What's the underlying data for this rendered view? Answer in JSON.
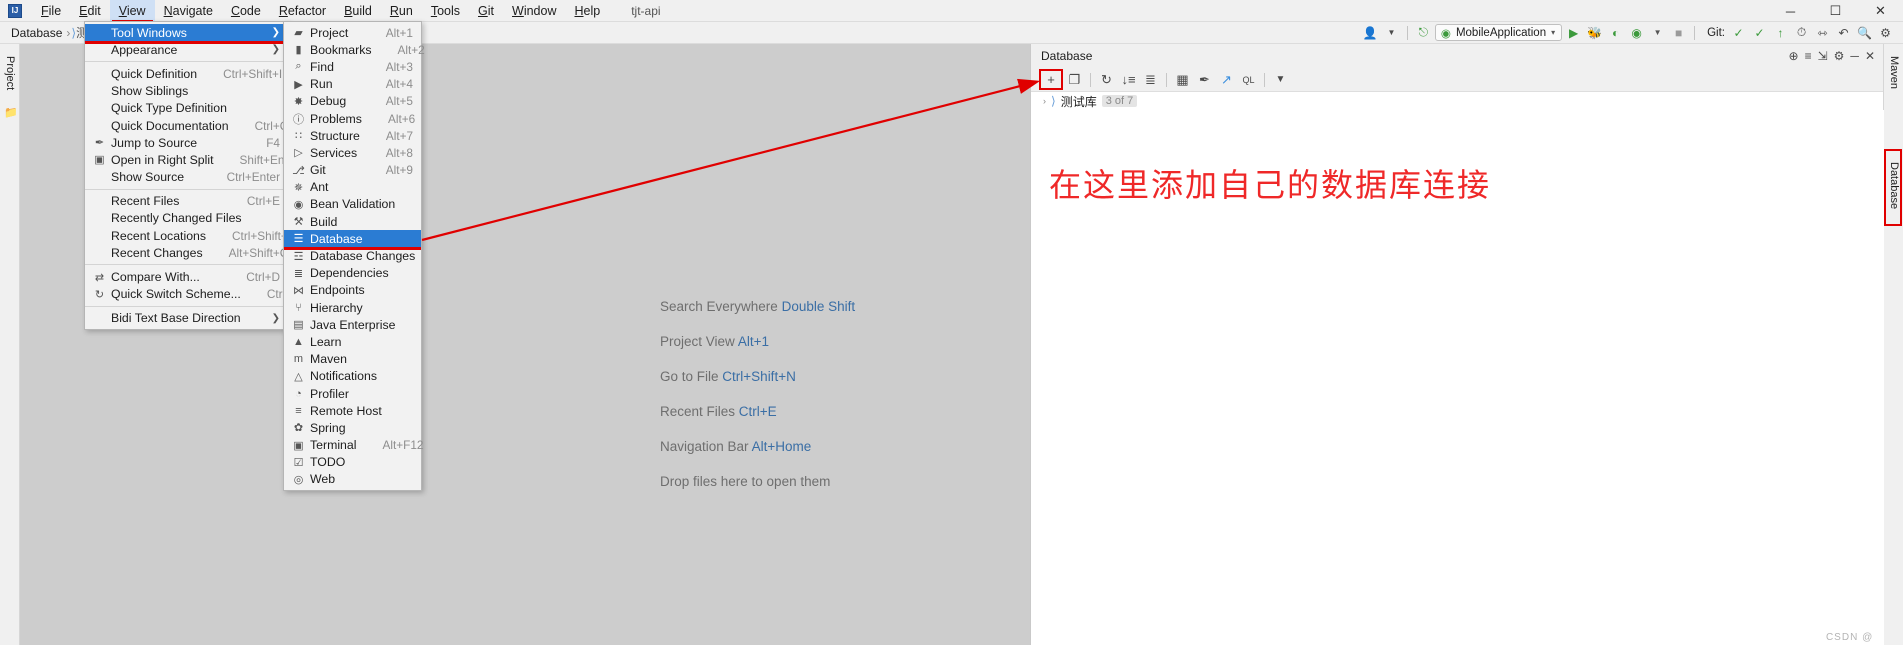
{
  "titlebar": {
    "logo": "IJ",
    "project_title": "tjt-api",
    "menus": [
      {
        "label": "File",
        "mnemonic": "F",
        "active": false
      },
      {
        "label": "Edit",
        "mnemonic": "E",
        "active": false
      },
      {
        "label": "View",
        "mnemonic": "V",
        "active": true
      },
      {
        "label": "Navigate",
        "mnemonic": "N",
        "active": false
      },
      {
        "label": "Code",
        "mnemonic": "C",
        "active": false
      },
      {
        "label": "Refactor",
        "mnemonic": "R",
        "active": false
      },
      {
        "label": "Build",
        "mnemonic": "B",
        "active": false
      },
      {
        "label": "Run",
        "mnemonic": "R",
        "active": false
      },
      {
        "label": "Tools",
        "mnemonic": "T",
        "active": false
      },
      {
        "label": "Git",
        "mnemonic": "G",
        "active": false
      },
      {
        "label": "Window",
        "mnemonic": "W",
        "active": false
      },
      {
        "label": "Help",
        "mnemonic": "H",
        "active": false
      }
    ],
    "window_controls": [
      {
        "name": "minimize-button",
        "glyph": "─"
      },
      {
        "name": "maximize-button",
        "glyph": "☐"
      },
      {
        "name": "close-button",
        "glyph": "✕"
      }
    ]
  },
  "navbar": {
    "crumbs": [
      "Database"
    ],
    "separator": "›"
  },
  "toolbar_right": {
    "account_icon": "user-icon",
    "hammer_icon": "build-icon",
    "run_config": {
      "label": "MobileApplication",
      "icon": "app-icon",
      "caret": "▾"
    },
    "buttons": [
      {
        "name": "run-button",
        "glyph": "▶",
        "color": "#3c9a3c"
      },
      {
        "name": "debug-button",
        "glyph": "🐞",
        "color": "#3c9a3c"
      },
      {
        "name": "run-coverage-button",
        "glyph": "◐",
        "color": "#3c9a3c"
      },
      {
        "name": "profiler-button",
        "glyph": "◉",
        "color": "#3c9a3c"
      },
      {
        "name": "stop-button",
        "glyph": "■",
        "color": "#8a8a8a"
      }
    ],
    "git_label": "Git:",
    "git_buttons": [
      {
        "name": "git-update-button",
        "glyph": "✓",
        "color": "#3c9a3c"
      },
      {
        "name": "git-commit-button",
        "glyph": "✓",
        "color": "#3c9a3c"
      },
      {
        "name": "git-push-button",
        "glyph": "↑",
        "color": "#3c9a3c"
      },
      {
        "name": "git-history-button",
        "glyph": "◴",
        "color": "#4a4a4a"
      },
      {
        "name": "git-branch-button",
        "glyph": "⎇",
        "color": "#4a4a4a"
      },
      {
        "name": "undo-button",
        "glyph": "↶",
        "color": "#4a4a4a"
      },
      {
        "name": "search-everywhere-button",
        "glyph": "⌕",
        "color": "#4a4a4a"
      },
      {
        "name": "settings-button",
        "glyph": "⚙",
        "color": "#4a4a4a"
      }
    ]
  },
  "left_strip": {
    "tabs": [
      {
        "label": "Project",
        "icon": "project-icon"
      }
    ]
  },
  "right_strip": {
    "tabs": [
      {
        "label": "Maven",
        "icon": "maven-icon"
      },
      {
        "label": "Database",
        "icon": "database-icon",
        "highlighted": true
      }
    ]
  },
  "welcome": {
    "lines": [
      {
        "text": "Search Everywhere",
        "shortcut": "Double Shift"
      },
      {
        "text": "Project View",
        "shortcut": "Alt+1"
      },
      {
        "text": "Go to File",
        "shortcut": "Ctrl+Shift+N"
      },
      {
        "text": "Recent Files",
        "shortcut": "Ctrl+E"
      },
      {
        "text": "Navigation Bar",
        "shortcut": "Alt+Home"
      },
      {
        "text": "Drop files here to open them",
        "shortcut": ""
      }
    ]
  },
  "database_panel": {
    "title": "Database",
    "header_icons": [
      {
        "name": "db-help-icon",
        "glyph": "⊕"
      },
      {
        "name": "db-collapse-all-icon",
        "glyph": "≡"
      },
      {
        "name": "db-expand-icon",
        "glyph": "⇲"
      },
      {
        "name": "db-settings-icon",
        "glyph": "⚙"
      },
      {
        "name": "db-hide-icon",
        "glyph": "─"
      },
      {
        "name": "db-close-icon",
        "glyph": "✕"
      }
    ],
    "toolbar": [
      {
        "name": "add-datasource-button",
        "glyph": "+",
        "highlighted": true
      },
      {
        "name": "duplicate-button",
        "glyph": "❐",
        "highlighted": false
      },
      {
        "name": "refresh-button",
        "glyph": "↻",
        "highlighted": false
      },
      {
        "name": "sync-button",
        "glyph": "↓≡",
        "highlighted": false
      },
      {
        "name": "db-objects-button",
        "glyph": "≣",
        "highlighted": false
      },
      {
        "name": "table-editor-button",
        "glyph": "▦",
        "highlighted": false
      },
      {
        "name": "modify-button",
        "glyph": "✒",
        "highlighted": false
      },
      {
        "name": "jump-to-editor-button",
        "glyph": "↗",
        "highlighted": false
      },
      {
        "name": "query-console-button",
        "glyph": "QL",
        "highlighted": false
      },
      {
        "name": "filter-button",
        "glyph": "▼",
        "highlighted": false
      }
    ],
    "tree_node": {
      "expander": "›",
      "icon": "db-connection-icon",
      "label": "测试库",
      "badge": "3 of 7"
    },
    "annotation_text": "在这里添加自己的数据库连接"
  },
  "menu_view": {
    "items": [
      {
        "label": "Tool Windows",
        "mnemonic": "T",
        "accel": "",
        "icon": "",
        "submenu": true,
        "selected": true
      },
      {
        "label": "Appearance",
        "mnemonic": "A",
        "accel": "",
        "icon": "",
        "submenu": true,
        "selected": false
      },
      {
        "separator": true
      },
      {
        "label": "Quick Definition",
        "mnemonic": "k",
        "accel": "Ctrl+Shift+I",
        "icon": "",
        "submenu": false,
        "selected": false
      },
      {
        "label": "Show Siblings",
        "mnemonic": "",
        "accel": "",
        "icon": "",
        "submenu": false,
        "selected": false
      },
      {
        "label": "Quick Type Definition",
        "mnemonic": "",
        "accel": "",
        "icon": "",
        "submenu": false,
        "selected": false
      },
      {
        "label": "Quick Documentation",
        "mnemonic": "D",
        "accel": "Ctrl+Q",
        "icon": "",
        "submenu": false,
        "selected": false
      },
      {
        "label": "Jump to Source",
        "mnemonic": "",
        "accel": "F4",
        "icon": "pencil-icon",
        "submenu": false,
        "selected": false
      },
      {
        "label": "Open in Right Split",
        "mnemonic": "",
        "accel": "Shift+Enter",
        "icon": "split-icon",
        "submenu": false,
        "selected": false
      },
      {
        "label": "Show Source",
        "mnemonic": "",
        "accel": "Ctrl+Enter",
        "icon": "",
        "submenu": false,
        "selected": false
      },
      {
        "separator": true
      },
      {
        "label": "Recent Files",
        "mnemonic": "t",
        "accel": "Ctrl+E",
        "icon": "",
        "submenu": false,
        "selected": false
      },
      {
        "label": "Recently Changed Files",
        "mnemonic": "",
        "accel": "",
        "icon": "",
        "submenu": false,
        "selected": false
      },
      {
        "label": "Recent Locations",
        "mnemonic": "",
        "accel": "Ctrl+Shift+E",
        "icon": "",
        "submenu": false,
        "selected": false
      },
      {
        "label": "Recent Changes",
        "mnemonic": "e",
        "accel": "Alt+Shift+C",
        "icon": "",
        "submenu": false,
        "selected": false
      },
      {
        "separator": true
      },
      {
        "label": "Compare With...",
        "mnemonic": "",
        "accel": "Ctrl+D",
        "icon": "compare-icon",
        "submenu": false,
        "selected": false
      },
      {
        "label": "Quick Switch Scheme...",
        "mnemonic": "",
        "accel": "Ctrl+`",
        "icon": "switch-icon",
        "submenu": false,
        "selected": false
      },
      {
        "separator": true
      },
      {
        "label": "Bidi Text Base Direction",
        "mnemonic": "",
        "accel": "",
        "icon": "",
        "submenu": true,
        "selected": false
      }
    ]
  },
  "menu_tool_windows": {
    "items": [
      {
        "label": "Project",
        "accel": "Alt+1",
        "icon": "folder-icon",
        "selected": false
      },
      {
        "label": "Bookmarks",
        "accel": "Alt+2",
        "icon": "bookmark-icon",
        "selected": false
      },
      {
        "label": "Find",
        "accel": "Alt+3",
        "icon": "search-icon",
        "selected": false
      },
      {
        "label": "Run",
        "accel": "Alt+4",
        "icon": "run-icon",
        "selected": false
      },
      {
        "label": "Debug",
        "accel": "Alt+5",
        "icon": "bug-icon",
        "selected": false
      },
      {
        "label": "Problems",
        "accel": "Alt+6",
        "icon": "problems-icon",
        "selected": false
      },
      {
        "label": "Structure",
        "accel": "Alt+7",
        "icon": "structure-icon",
        "selected": false
      },
      {
        "label": "Services",
        "accel": "Alt+8",
        "icon": "services-icon",
        "selected": false
      },
      {
        "label": "Git",
        "accel": "Alt+9",
        "icon": "git-icon",
        "selected": false
      },
      {
        "label": "Ant",
        "accel": "",
        "icon": "ant-icon",
        "selected": false
      },
      {
        "label": "Bean Validation",
        "accel": "",
        "icon": "bean-icon",
        "selected": false
      },
      {
        "label": "Build",
        "accel": "",
        "icon": "hammer-icon",
        "selected": false
      },
      {
        "label": "Database",
        "accel": "",
        "icon": "database-icon",
        "selected": true
      },
      {
        "label": "Database Changes",
        "accel": "",
        "icon": "db-changes-icon",
        "selected": false
      },
      {
        "label": "Dependencies",
        "accel": "",
        "icon": "layers-icon",
        "selected": false
      },
      {
        "label": "Endpoints",
        "accel": "",
        "icon": "endpoints-icon",
        "selected": false
      },
      {
        "label": "Hierarchy",
        "accel": "",
        "icon": "hierarchy-icon",
        "selected": false
      },
      {
        "label": "Java Enterprise",
        "accel": "",
        "icon": "jee-icon",
        "selected": false
      },
      {
        "label": "Learn",
        "accel": "",
        "icon": "learn-icon",
        "selected": false
      },
      {
        "label": "Maven",
        "accel": "",
        "icon": "maven-icon",
        "selected": false
      },
      {
        "label": "Notifications",
        "accel": "",
        "icon": "bell-icon",
        "selected": false
      },
      {
        "label": "Profiler",
        "accel": "",
        "icon": "profiler-icon",
        "selected": false
      },
      {
        "label": "Remote Host",
        "accel": "",
        "icon": "remote-host-icon",
        "selected": false
      },
      {
        "label": "Spring",
        "accel": "",
        "icon": "spring-icon",
        "selected": false
      },
      {
        "label": "Terminal",
        "accel": "Alt+F12",
        "icon": "terminal-icon",
        "selected": false
      },
      {
        "label": "TODO",
        "accel": "",
        "icon": "todo-icon",
        "selected": false
      },
      {
        "label": "Web",
        "accel": "",
        "icon": "web-icon",
        "selected": false
      }
    ]
  },
  "watermark": "CSDN @ ",
  "colors": {
    "accent_blue": "#2b7cd3",
    "annotation_red": "#e00000",
    "note_red": "#ef2828",
    "link_blue": "#3a6ea5"
  }
}
